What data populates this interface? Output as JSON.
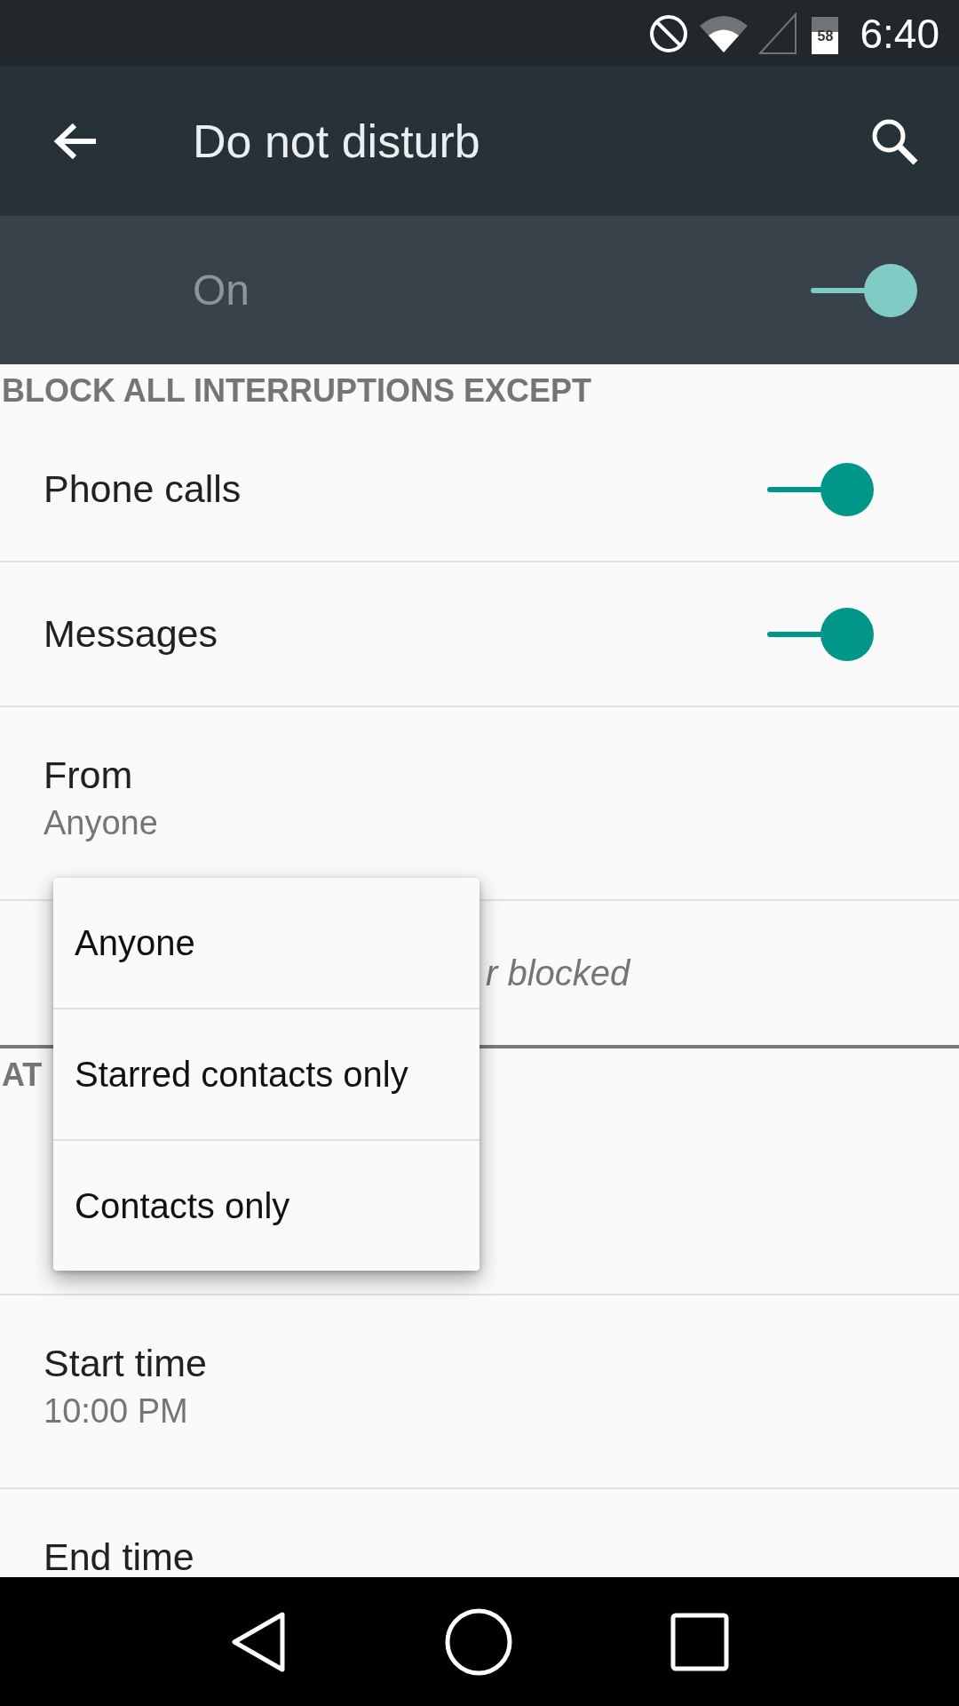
{
  "status_bar": {
    "time": "6:40",
    "battery": "58"
  },
  "app_bar": {
    "title": "Do not disturb"
  },
  "master": {
    "label": "On",
    "on": true
  },
  "sections": [
    {
      "header": "BLOCK ALL INTERRUPTIONS EXCEPT",
      "rows": [
        {
          "kind": "switch",
          "title": "Phone calls",
          "on": true
        },
        {
          "kind": "switch",
          "title": "Messages",
          "on": true
        },
        {
          "kind": "value",
          "title": "From",
          "subtitle": "Anyone"
        },
        {
          "kind": "note",
          "fragments": [
            "r blocked"
          ]
        }
      ]
    },
    {
      "header": "AT",
      "rows": [
        {
          "kind": "covered"
        },
        {
          "kind": "value",
          "title": "Start time",
          "subtitle": "10:00 PM"
        },
        {
          "kind": "value",
          "title": "End time"
        }
      ]
    }
  ],
  "popup_menu": {
    "items": [
      {
        "label": "Anyone"
      },
      {
        "label": "Starred contacts only"
      },
      {
        "label": "Contacts only"
      }
    ]
  }
}
